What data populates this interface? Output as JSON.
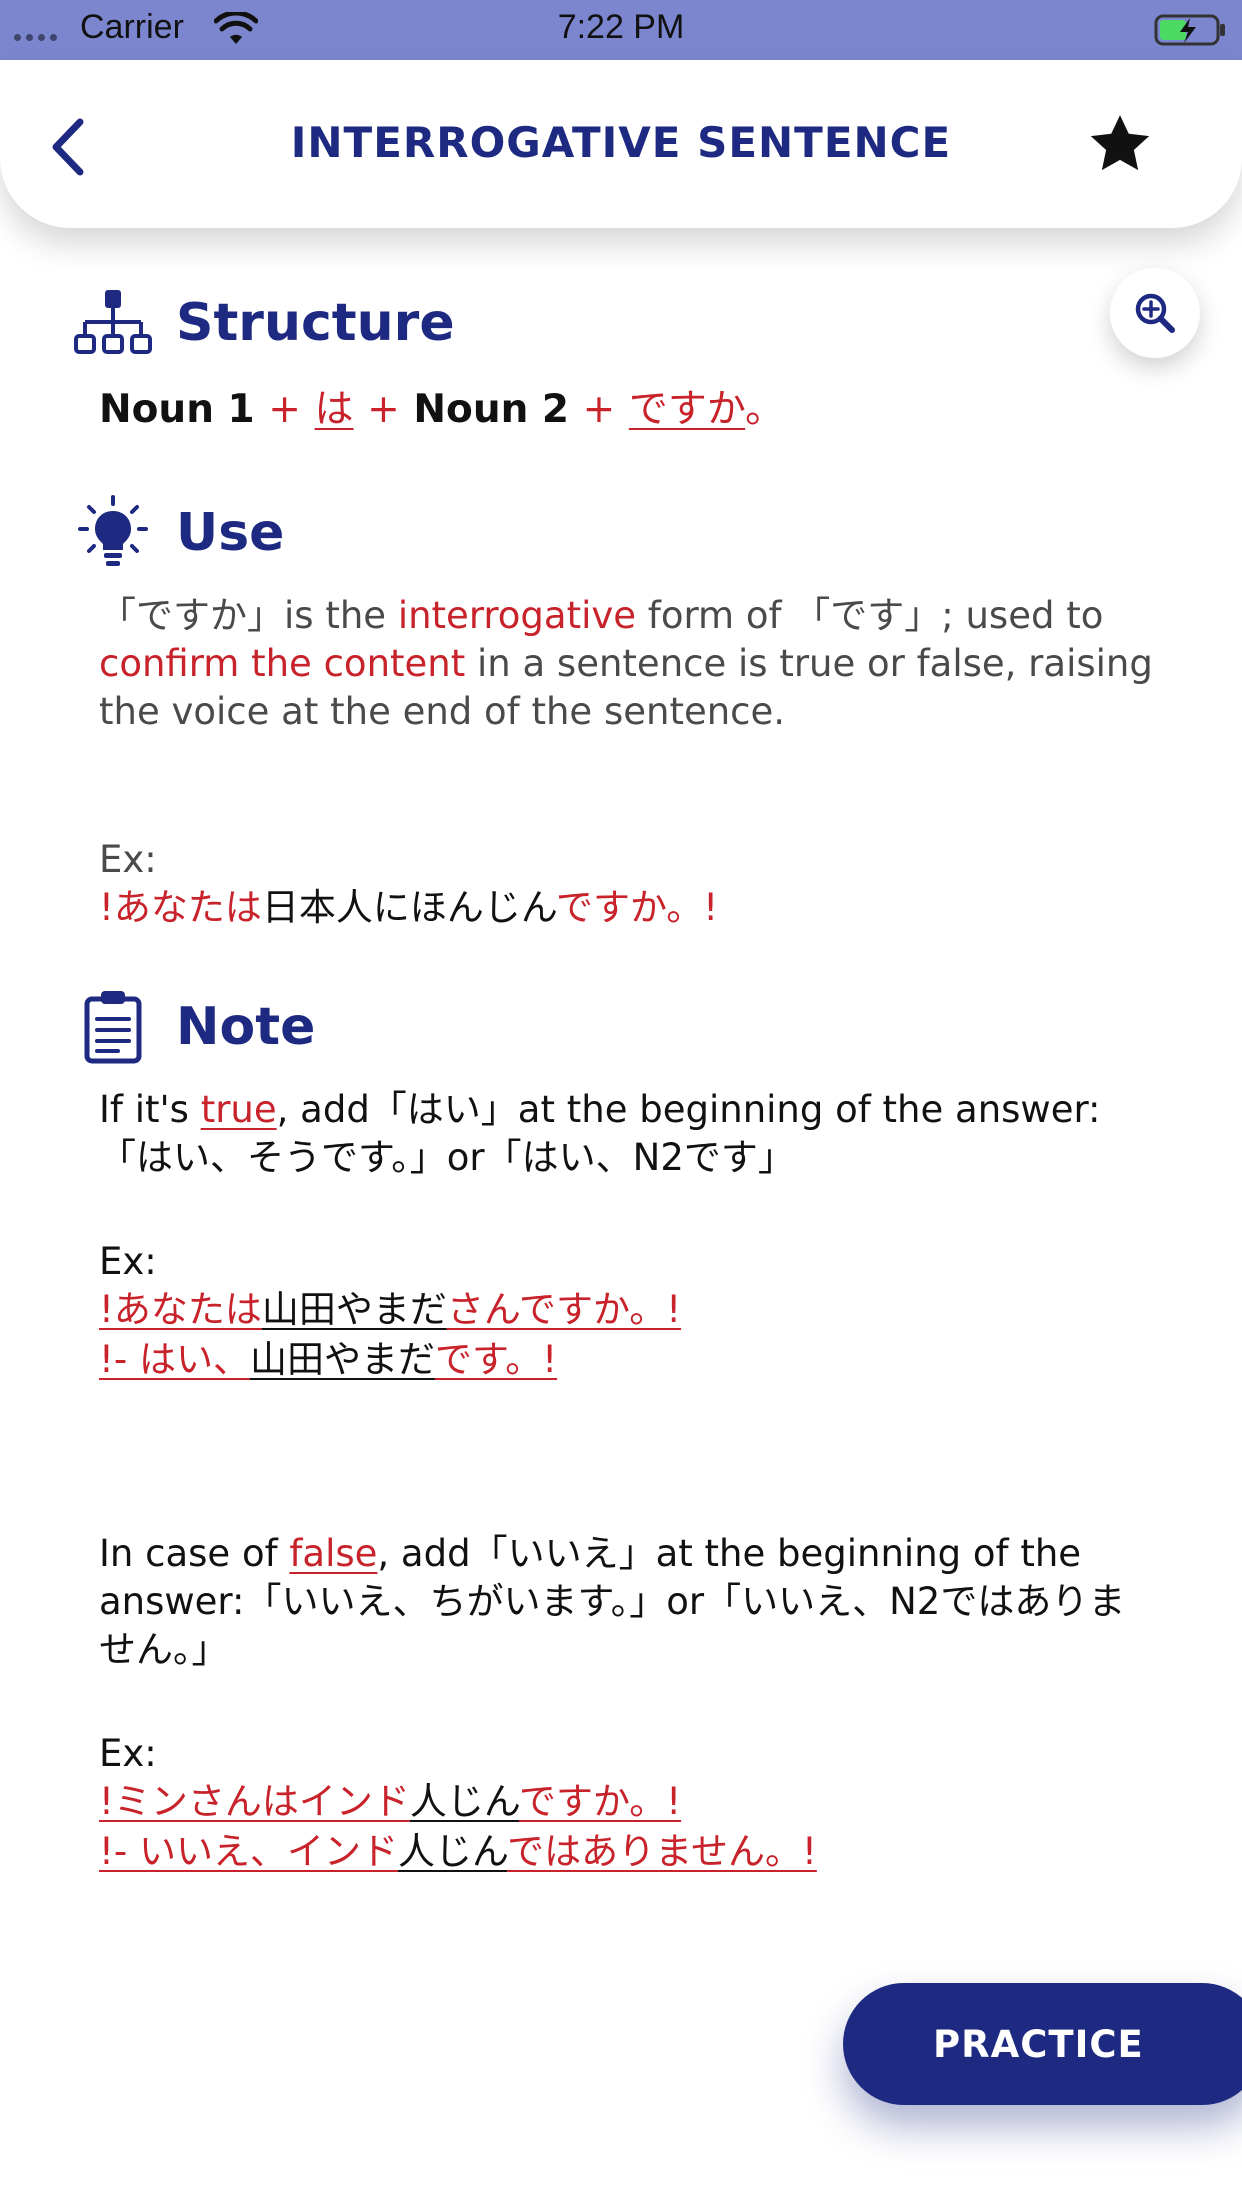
{
  "status_bar": {
    "carrier": "Carrier",
    "time": "7:22 PM"
  },
  "header": {
    "title": "INTERROGATIVE SENTENCE"
  },
  "structure": {
    "title": "Structure",
    "noun1": "Noun 1",
    "plus": "+",
    "particle": "は",
    "noun2": "Noun 2",
    "desuka": "ですか",
    "period": "。"
  },
  "use": {
    "title": "Use",
    "p1": "「ですか」is the ",
    "p1_red": "interrogative",
    "p2": " form of 「です」;",
    "p3": "used to ",
    "p3_red": "confirm the content",
    "p4": " in a sentence is true or false, raising the voice at the end of the sentence.",
    "ex_label": "Ex:",
    "ex_red1": "!あなたは",
    "ex_black": "日本人にほんじん",
    "ex_red2": "ですか。!"
  },
  "note": {
    "title": "Note",
    "true_p1": "If it's ",
    "true_word": "true",
    "true_p2": ", add「はい」at the beginning of the answer:「はい、そうです。」or「はい、N2です」",
    "ex1_label": "Ex:",
    "ex1_l1_red1": "!あなたは",
    "ex1_l1_black": "山田やまだ",
    "ex1_l1_red2": "さんですか。!",
    "ex1_l2_red1": "!- はい、",
    "ex1_l2_black": "山田やまだ",
    "ex1_l2_red2": "です。!",
    "false_p1": "In case of ",
    "false_word": "false",
    "false_p2": ", add「いいえ」at the beginning of the answer:「いいえ、ちがいます。」or「いいえ、N2ではありません。」",
    "ex2_label": "Ex:",
    "ex2_l1_red1": "!ミンさんはインド",
    "ex2_l1_black": "人じん",
    "ex2_l1_red2": "ですか。!",
    "ex2_l2_red1": "!- いいえ、インド",
    "ex2_l2_black": "人じん",
    "ex2_l2_red2": "ではありません。!"
  },
  "practice_button": {
    "label": "PRACTICE"
  },
  "colors": {
    "primary": "#1e2a82",
    "accent_red": "#c8222a",
    "status_bar": "#7b86ce"
  }
}
